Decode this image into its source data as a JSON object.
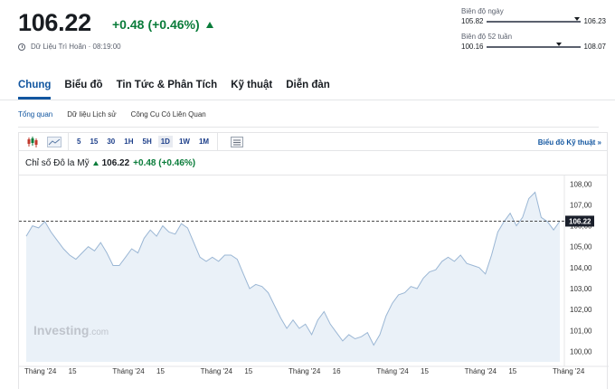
{
  "header": {
    "price": "106.22",
    "change": "+0.48",
    "change_pct": "(+0.46%)",
    "delayed_text": "Dữ Liệu Trì Hoãn · 08:19:00"
  },
  "ranges": {
    "day": {
      "label": "Biên độ ngày",
      "low": "105.82",
      "high": "106.23",
      "current_position": 0.97
    },
    "year": {
      "label": "Biên độ 52 tuần",
      "low": "100.16",
      "high": "108.07",
      "current_position": 0.77
    }
  },
  "tabs": [
    "Chung",
    "Biểu đồ",
    "Tin Tức & Phân Tích",
    "Kỹ thuật",
    "Diễn đàn"
  ],
  "subtabs": [
    "Tổng quan",
    "Dữ liệu Lịch sử",
    "Công Cụ Có Liên Quan"
  ],
  "toolbar": {
    "periods": [
      "5",
      "15",
      "30",
      "1H",
      "5H",
      "1D",
      "1W",
      "1M"
    ],
    "active_period": "1D",
    "advanced_link": "Biểu đồ Kỹ thuật »"
  },
  "legend": {
    "name": "Chỉ số Đô la Mỹ",
    "value": "106.22",
    "change": "+0.48 (+0.46%)"
  },
  "watermark": {
    "main": "Investing",
    "suffix": ".com"
  },
  "colors": {
    "accent": "#1256a0",
    "positive": "#0a7c3a",
    "line": "#9ab6d4",
    "fill": "#eaf1f8"
  },
  "chart_data": {
    "type": "area",
    "y_ticks": [
      "100,00",
      "101,00",
      "102,00",
      "103,00",
      "104,00",
      "105,00",
      "106,00",
      "107,00",
      "108,00"
    ],
    "ylim": [
      99.5,
      108.4
    ],
    "x_ticks": [
      "Tháng '24",
      "15",
      "Tháng '24",
      "15",
      "Tháng '24",
      "15",
      "Tháng '24",
      "16",
      "Tháng '24",
      "15",
      "Tháng '24",
      "15",
      "Tháng '24"
    ],
    "current_value": 106.22,
    "current_label": "106.22",
    "values": [
      105.5,
      106.0,
      105.9,
      106.2,
      105.7,
      105.3,
      104.9,
      104.6,
      104.4,
      104.7,
      105.0,
      104.8,
      105.2,
      104.7,
      104.1,
      104.1,
      104.5,
      104.9,
      104.7,
      105.4,
      105.8,
      105.5,
      106.0,
      105.7,
      105.6,
      106.1,
      105.9,
      105.2,
      104.5,
      104.3,
      104.5,
      104.3,
      104.6,
      104.6,
      104.4,
      103.7,
      103.0,
      103.2,
      103.1,
      102.8,
      102.2,
      101.6,
      101.1,
      101.5,
      101.1,
      101.3,
      100.8,
      101.5,
      101.9,
      101.3,
      100.9,
      100.5,
      100.8,
      100.6,
      100.7,
      100.9,
      100.3,
      100.8,
      101.7,
      102.3,
      102.7,
      102.8,
      103.1,
      103.0,
      103.5,
      103.8,
      103.9,
      104.3,
      104.5,
      104.3,
      104.6,
      104.2,
      104.1,
      104.0,
      103.7,
      104.6,
      105.7,
      106.2,
      106.6,
      106.0,
      106.4,
      107.3,
      107.6,
      106.4,
      106.2,
      105.8,
      106.22
    ]
  }
}
